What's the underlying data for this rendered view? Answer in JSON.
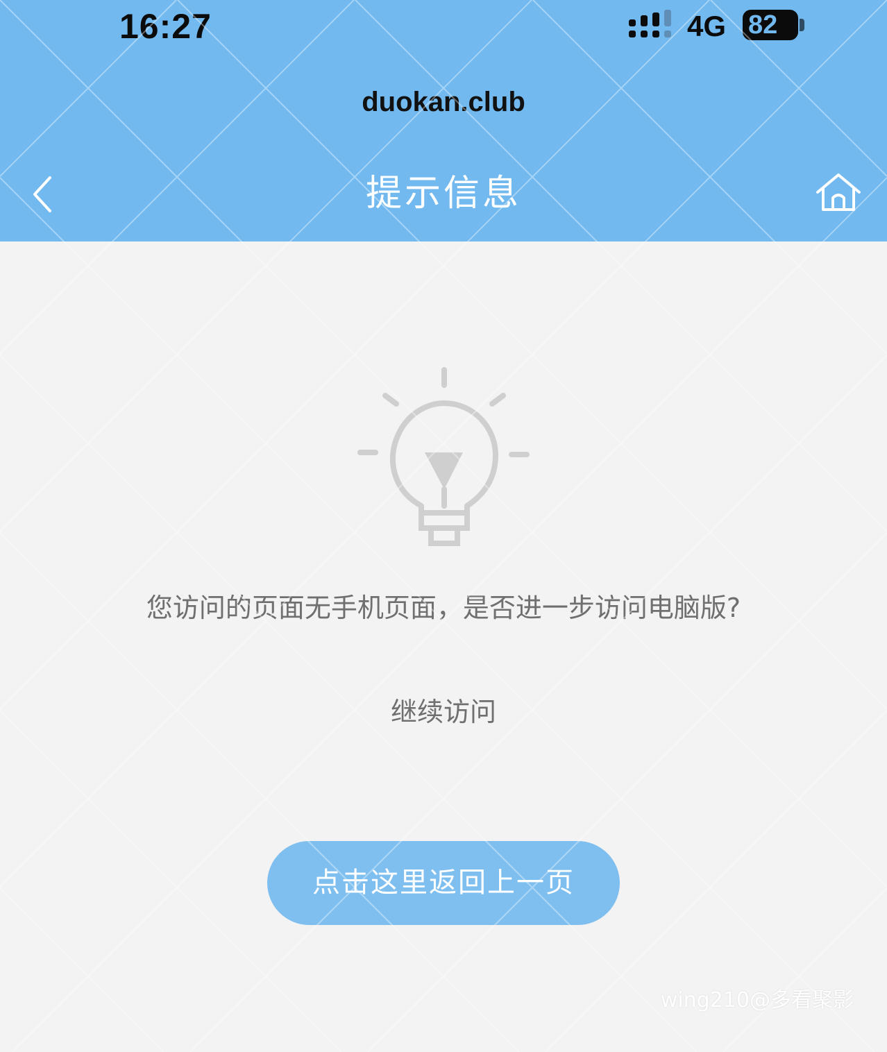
{
  "status_bar": {
    "time": "16:27",
    "network": "4G",
    "battery": "82"
  },
  "browser": {
    "url": "duokan.club"
  },
  "nav": {
    "title": "提示信息",
    "back_icon": "chevron-left-icon",
    "home_icon": "home-icon"
  },
  "main": {
    "icon": "lightbulb-icon",
    "message": "您访问的页面无手机页面，是否进一步访问电脑版?",
    "continue_label": "继续访问",
    "back_button_label": "点击这里返回上一页"
  },
  "watermark": {
    "credit": "wing210@多看聚影"
  },
  "colors": {
    "header": "#72b9ef",
    "background": "#f3f3f3",
    "button": "#7ebff0",
    "text": "#6f6f6f",
    "icon": "#cfcfcf"
  }
}
